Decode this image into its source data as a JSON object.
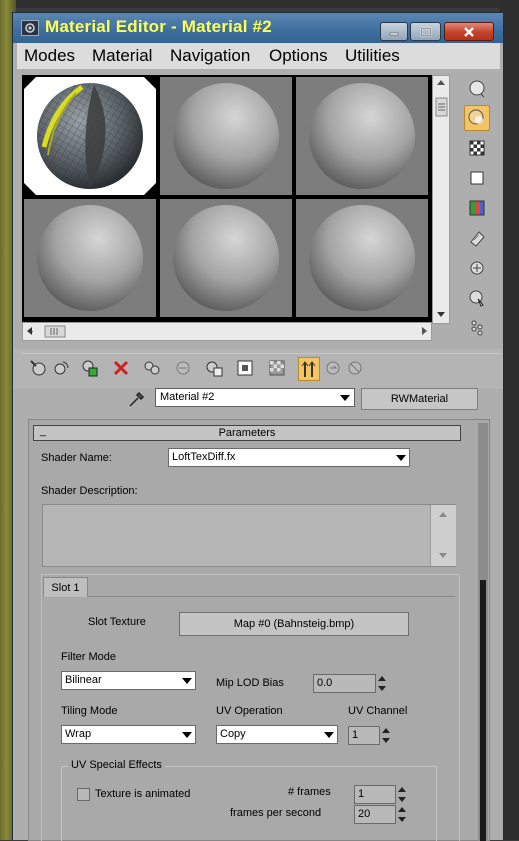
{
  "window": {
    "title": "Material Editor - Material #2"
  },
  "menu": [
    "Modes",
    "Material",
    "Navigation",
    "Options",
    "Utilities"
  ],
  "slots": {
    "selected_index": 0,
    "count": 6,
    "active_material": "Material #2"
  },
  "side_tools": [
    "sample-type-icon",
    "backlight-icon",
    "background-icon",
    "uv-tiling-icon",
    "video-color-check-icon",
    "make-preview-icon",
    "options-icon",
    "select-by-material-icon"
  ],
  "bottom_tools": [
    "get-material-icon",
    "put-to-scene-icon",
    "assign-to-selection-icon",
    "reset-map-icon",
    "make-unique-icon",
    "put-to-library-icon",
    "material-id-channel-icon",
    "show-in-viewport-icon",
    "show-end-result-icon",
    "go-to-parent-icon",
    "go-forward-sibling-icon"
  ],
  "material_name": "Material #2",
  "material_type": "RWMaterial",
  "params": {
    "title": "Parameters",
    "collapse": "_",
    "shader_name_label": "Shader Name:",
    "shader_name": "LoftTexDiff.fx",
    "shader_desc_label": "Shader Description:",
    "shader_desc": ""
  },
  "slot_tab": "Slot 1",
  "slot_texture": {
    "label": "Slot Texture",
    "map": "Map #0 (Bahnsteig.bmp)"
  },
  "filter_mode": {
    "label": "Filter Mode",
    "value": "Bilinear"
  },
  "mip_lod_bias": {
    "label": "Mip LOD Bias",
    "value": "0.0"
  },
  "tiling_mode": {
    "label": "Tiling Mode",
    "value": "Wrap"
  },
  "uv_operation": {
    "label": "UV Operation",
    "value": "Copy"
  },
  "uv_channel": {
    "label": "UV Channel",
    "value": "1"
  },
  "uv_fx": {
    "title": "UV Special Effects",
    "animated_label": "Texture is animated",
    "animated": false,
    "frames_label": "# frames",
    "frames": "1",
    "fps_label": "frames per second",
    "fps": "20"
  },
  "colors": {
    "title_text": "#ffff55",
    "titlebar": "#3d6e9e",
    "panel": "#aeaeae",
    "highlight_tool": "#f3c463"
  }
}
